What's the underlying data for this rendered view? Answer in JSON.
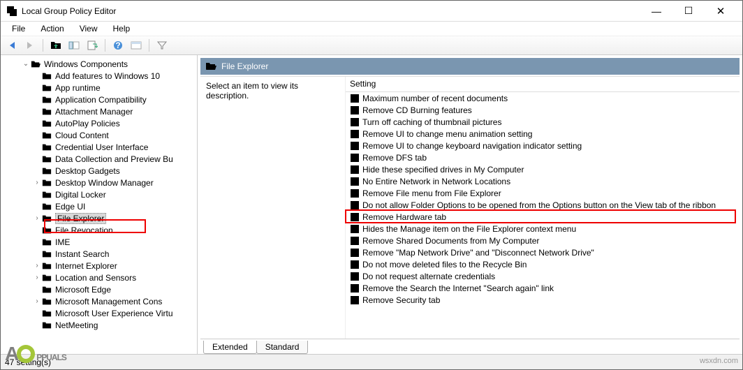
{
  "window": {
    "title": "Local Group Policy Editor"
  },
  "menu": {
    "items": [
      "File",
      "Action",
      "View",
      "Help"
    ]
  },
  "toolbar": {
    "icons": [
      "back-arrow",
      "forward-arrow",
      "up-folder",
      "show-hide-tree",
      "export-list",
      "refresh",
      "help",
      "show-hide-action",
      "filter"
    ]
  },
  "tree": {
    "parent": {
      "label": "Windows Components",
      "expanded": true
    },
    "items": [
      {
        "label": "Add features to Windows 10"
      },
      {
        "label": "App runtime"
      },
      {
        "label": "Application Compatibility"
      },
      {
        "label": "Attachment Manager"
      },
      {
        "label": "AutoPlay Policies"
      },
      {
        "label": "Cloud Content"
      },
      {
        "label": "Credential User Interface"
      },
      {
        "label": "Data Collection and Preview Bu"
      },
      {
        "label": "Desktop Gadgets"
      },
      {
        "label": "Desktop Window Manager",
        "hasChildren": true
      },
      {
        "label": "Digital Locker"
      },
      {
        "label": "Edge UI"
      },
      {
        "label": "File Explorer",
        "hasChildren": true,
        "selected": true
      },
      {
        "label": "File Revocation"
      },
      {
        "label": "IME"
      },
      {
        "label": "Instant Search"
      },
      {
        "label": "Internet Explorer",
        "hasChildren": true
      },
      {
        "label": "Location and Sensors",
        "hasChildren": true
      },
      {
        "label": "Microsoft Edge"
      },
      {
        "label": "Microsoft Management Cons",
        "hasChildren": true
      },
      {
        "label": "Microsoft User Experience Virtu"
      },
      {
        "label": "NetMeeting"
      }
    ]
  },
  "content": {
    "title": "File Explorer",
    "description": "Select an item to view its description.",
    "columnHeader": "Setting",
    "settings": [
      "Maximum number of recent documents",
      "Remove CD Burning features",
      "Turn off caching of thumbnail pictures",
      "Remove UI to change menu animation setting",
      "Remove UI to change keyboard navigation indicator setting",
      "Remove DFS tab",
      "Hide these specified drives in My Computer",
      "No Entire Network in Network Locations",
      "Remove File menu from File Explorer",
      "Do not allow Folder Options to be opened from the Options button on the View tab of the ribbon",
      "Remove Hardware tab",
      "Hides the Manage item on the File Explorer context menu",
      "Remove Shared Documents from My Computer",
      "Remove \"Map Network Drive\" and \"Disconnect Network Drive\"",
      "Do not move deleted files to the Recycle Bin",
      "Do not request alternate credentials",
      "Remove the Search the Internet \"Search again\" link",
      "Remove Security tab"
    ]
  },
  "tabs": {
    "items": [
      "Extended",
      "Standard"
    ],
    "active": 0
  },
  "status": {
    "text": "47 setting(s)"
  },
  "watermark": {
    "text": "PPUALS"
  },
  "footer": {
    "domain": "wsxdn.com"
  }
}
